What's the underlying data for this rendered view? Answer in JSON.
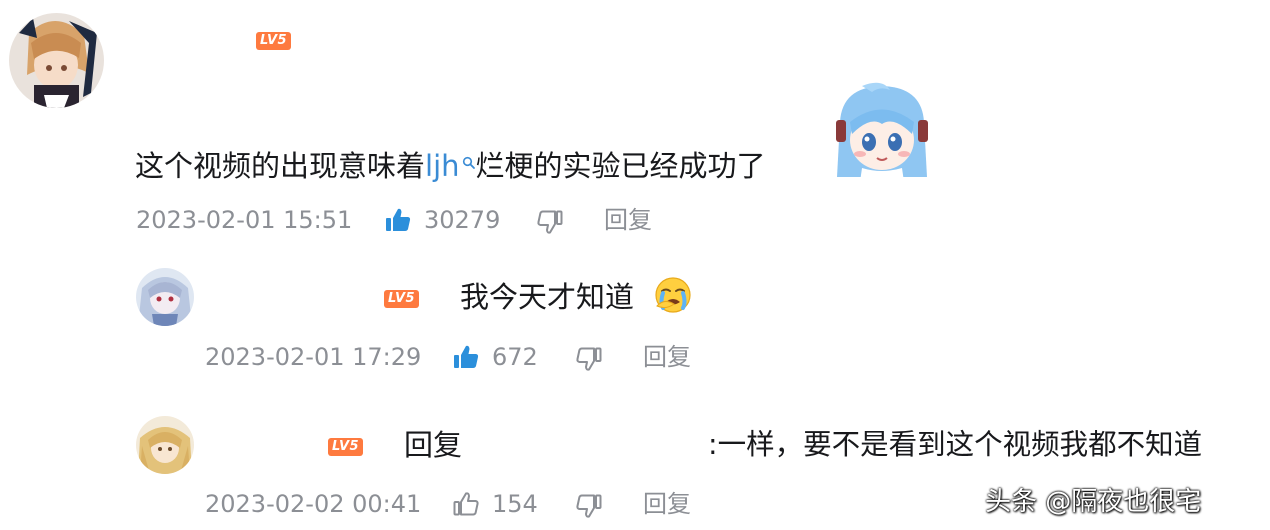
{
  "comments": [
    {
      "level": "LV5",
      "text_before": "这个视频的出现意味着",
      "keyword": "ljh",
      "text_after": "烂梗的实验已经成功了",
      "timestamp": "2023-02-01 15:51",
      "likes": "30279",
      "reply_label": "回复"
    },
    {
      "level": "LV5",
      "text": "我今天才知道",
      "timestamp": "2023-02-01 17:29",
      "likes": "672",
      "reply_label": "回复"
    },
    {
      "level": "LV5",
      "reply_prefix": "回复",
      "text": ":一样，要不是看到这个视频我都不知道",
      "timestamp": "2023-02-02 00:41",
      "likes": "154",
      "reply_label": "回复"
    }
  ],
  "watermark": "头条 @隔夜也很宅",
  "colors": {
    "level_badge": "#fe7a3f",
    "like_active": "#2b8fdb",
    "keyword": "#3a8bd4",
    "meta_text": "#8c8f95"
  },
  "icons": [
    "like-icon",
    "dislike-icon",
    "search-icon",
    "sticker-icon",
    "crying-emoji-icon"
  ]
}
